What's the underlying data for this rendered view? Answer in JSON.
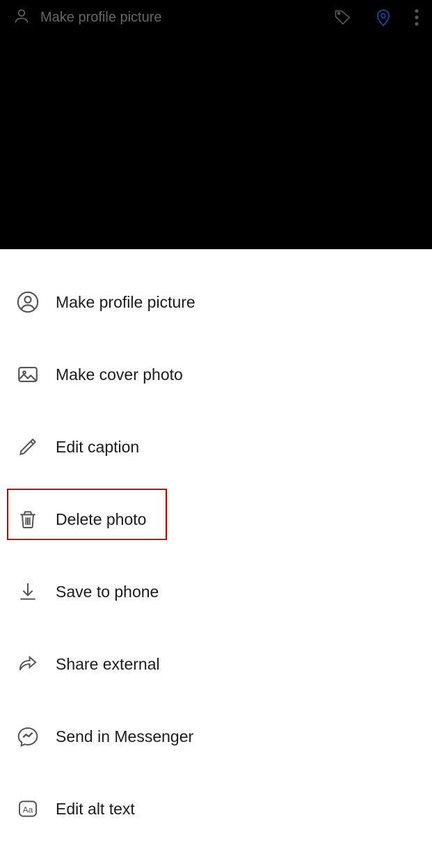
{
  "header": {
    "title": "Make profile picture"
  },
  "menu": {
    "items": [
      {
        "label": "Make profile picture"
      },
      {
        "label": "Make cover photo"
      },
      {
        "label": "Edit caption"
      },
      {
        "label": "Delete photo"
      },
      {
        "label": "Save to phone"
      },
      {
        "label": "Share external"
      },
      {
        "label": "Send in Messenger"
      },
      {
        "label": "Edit alt text"
      }
    ]
  },
  "highlight": {
    "target_label": "Delete photo",
    "color": "#c00000"
  }
}
